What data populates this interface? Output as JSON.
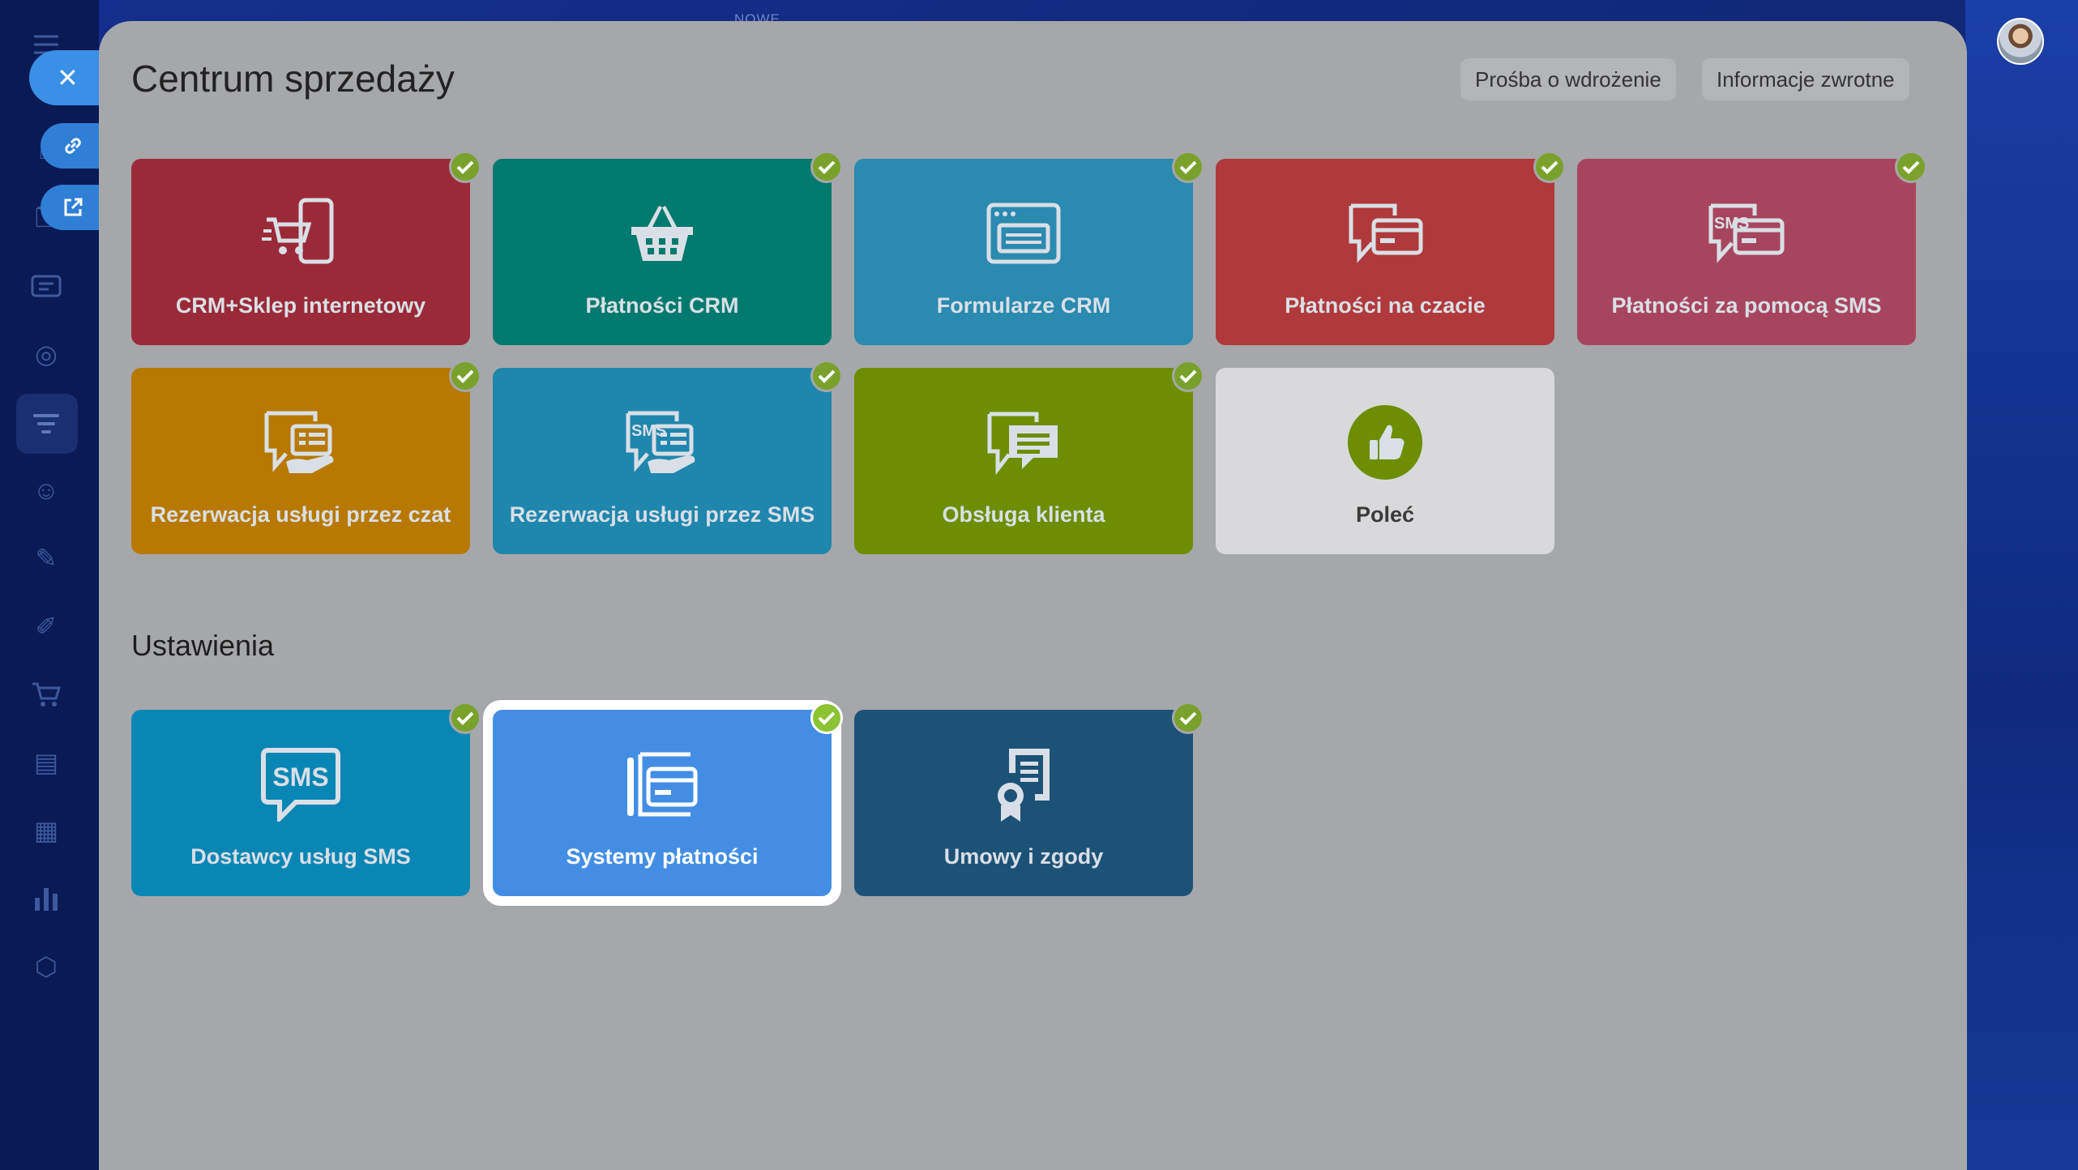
{
  "background": {
    "top_label": "NOWE"
  },
  "slider": {
    "title": "Centrum sprzedaży",
    "buttons": {
      "implementation": "Prośba o wdrożenie",
      "feedback": "Informacje zwrotne"
    },
    "sales_tiles": [
      {
        "label": "CRM+Sklep internetowy",
        "color": "#9b2a38",
        "icon": "cart-mobile-icon",
        "checked": true
      },
      {
        "label": "Płatności CRM",
        "color": "#00796e",
        "icon": "basket-icon",
        "checked": true
      },
      {
        "label": "Formularze CRM",
        "color": "#2a8ab0",
        "icon": "form-window-icon",
        "checked": true
      },
      {
        "label": "Płatności na czacie",
        "color": "#b0393b",
        "icon": "chat-card-icon",
        "checked": true
      },
      {
        "label": "Płatności za pomocą SMS",
        "color": "#a8455e",
        "icon": "sms-card-icon",
        "checked": true
      },
      {
        "label": "Rezerwacja usługi przez czat",
        "color": "#b77900",
        "icon": "chat-booking-icon",
        "checked": true
      },
      {
        "label": "Rezerwacja usługi przez SMS",
        "color": "#1f86ad",
        "icon": "sms-booking-icon",
        "checked": true
      },
      {
        "label": "Obsługa klienta",
        "color": "#6c8e00",
        "icon": "chat-bubbles-icon",
        "checked": true
      },
      {
        "label": "Poleć",
        "color": "#d9d9db",
        "icon": "thumbs-up-icon",
        "checked": false
      }
    ],
    "settings_title": "Ustawienia",
    "settings_tiles": [
      {
        "label": "Dostawcy usług SMS",
        "color": "#0a86b4",
        "icon": "sms-bubble-icon",
        "checked": true
      },
      {
        "label": "Systemy płatności",
        "color": "#438ee4",
        "icon": "payment-cards-icon",
        "checked": true
      },
      {
        "label": "Umowy i zgody",
        "color": "#1d5277",
        "icon": "certificate-icon",
        "checked": true
      }
    ],
    "sms_glyph": "SMS"
  },
  "colors": {
    "check": "#7aa12c",
    "panel_bg": "#a6a7aa",
    "highlight": "#ffffff"
  }
}
